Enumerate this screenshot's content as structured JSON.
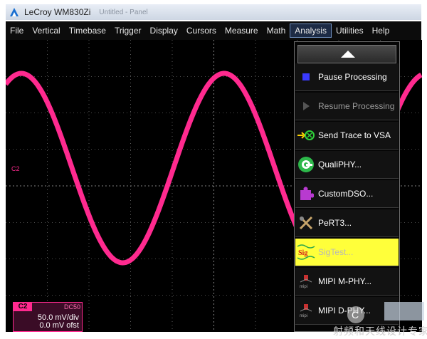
{
  "window": {
    "title": "LeCroy WM830Zi",
    "blur_text": "Untitled - Panel",
    "colors": {
      "titlebar": "#d7dfea"
    }
  },
  "menubar": {
    "items": [
      {
        "label": "File"
      },
      {
        "label": "Vertical"
      },
      {
        "label": "Timebase"
      },
      {
        "label": "Trigger"
      },
      {
        "label": "Display"
      },
      {
        "label": "Cursors"
      },
      {
        "label": "Measure"
      },
      {
        "label": "Math"
      },
      {
        "label": "Analysis",
        "active": true
      },
      {
        "label": "Utilities"
      },
      {
        "label": "Help"
      }
    ]
  },
  "scope": {
    "trace_color": "#ff2a8f",
    "grid_color": "#9a9a9a",
    "channel_marker": "C2"
  },
  "channel_box": {
    "name": "C2",
    "coupling": "DC50",
    "scale": "50.0 mV/div",
    "offset": "0.0 mV ofst"
  },
  "analysis_menu": {
    "scroll_up_icon": "triangle-up-icon",
    "items": [
      {
        "label": "Pause Processing",
        "icon": "square-stop-icon",
        "enabled": true
      },
      {
        "label": "Resume Processing",
        "icon": "play-triangle-icon",
        "enabled": false
      },
      {
        "label": "Send Trace to VSA",
        "icon": "vsa-arrow-icon",
        "enabled": true
      },
      {
        "label": "QualiPHY...",
        "icon": "qualiphy-icon",
        "enabled": true
      },
      {
        "label": "CustomDSO...",
        "icon": "puzzle-icon",
        "enabled": true
      },
      {
        "label": "PeRT3...",
        "icon": "tools-icon",
        "enabled": true
      },
      {
        "label": "SigTest...",
        "icon": "sig-icon",
        "enabled": true,
        "highlighted": true
      },
      {
        "label": "MIPI M-PHY...",
        "icon": "mipi-icon",
        "enabled": true
      },
      {
        "label": "MIPI D-PHY...",
        "icon": "mipi-icon",
        "enabled": true
      }
    ]
  },
  "watermark": {
    "text": "射频和天线设计专家"
  }
}
